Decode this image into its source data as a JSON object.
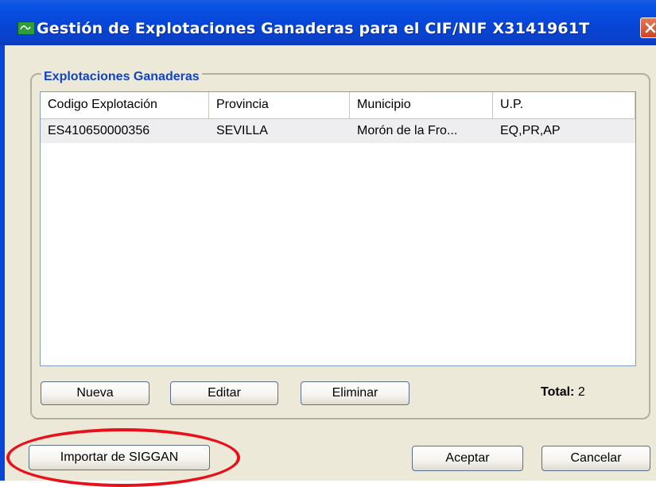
{
  "window": {
    "title": "Gestión de Explotaciones Ganaderas para el CIF/NIF X3141961T",
    "app_icon": "app-icon",
    "close_icon": "close-icon"
  },
  "group": {
    "legend": "Explotaciones Ganaderas"
  },
  "table": {
    "columns": [
      "Codigo Explotación",
      "Provincia",
      "Municipio",
      "U.P."
    ],
    "rows": [
      [
        "ES410650000356",
        "SEVILLA",
        "Morón de la Fro...",
        "EQ,PR,AP"
      ]
    ]
  },
  "actions": {
    "new_label": "Nueva",
    "edit_label": "Editar",
    "delete_label": "Eliminar",
    "total_label": "Total:",
    "total_value": "2"
  },
  "footer": {
    "import_label": "Importar de SIGGAN",
    "accept_label": "Aceptar",
    "cancel_label": "Cancelar"
  },
  "colors": {
    "titlebar": "#0a46d6",
    "legend_text": "#1143c8",
    "highlight_ellipse": "#e8101a"
  }
}
